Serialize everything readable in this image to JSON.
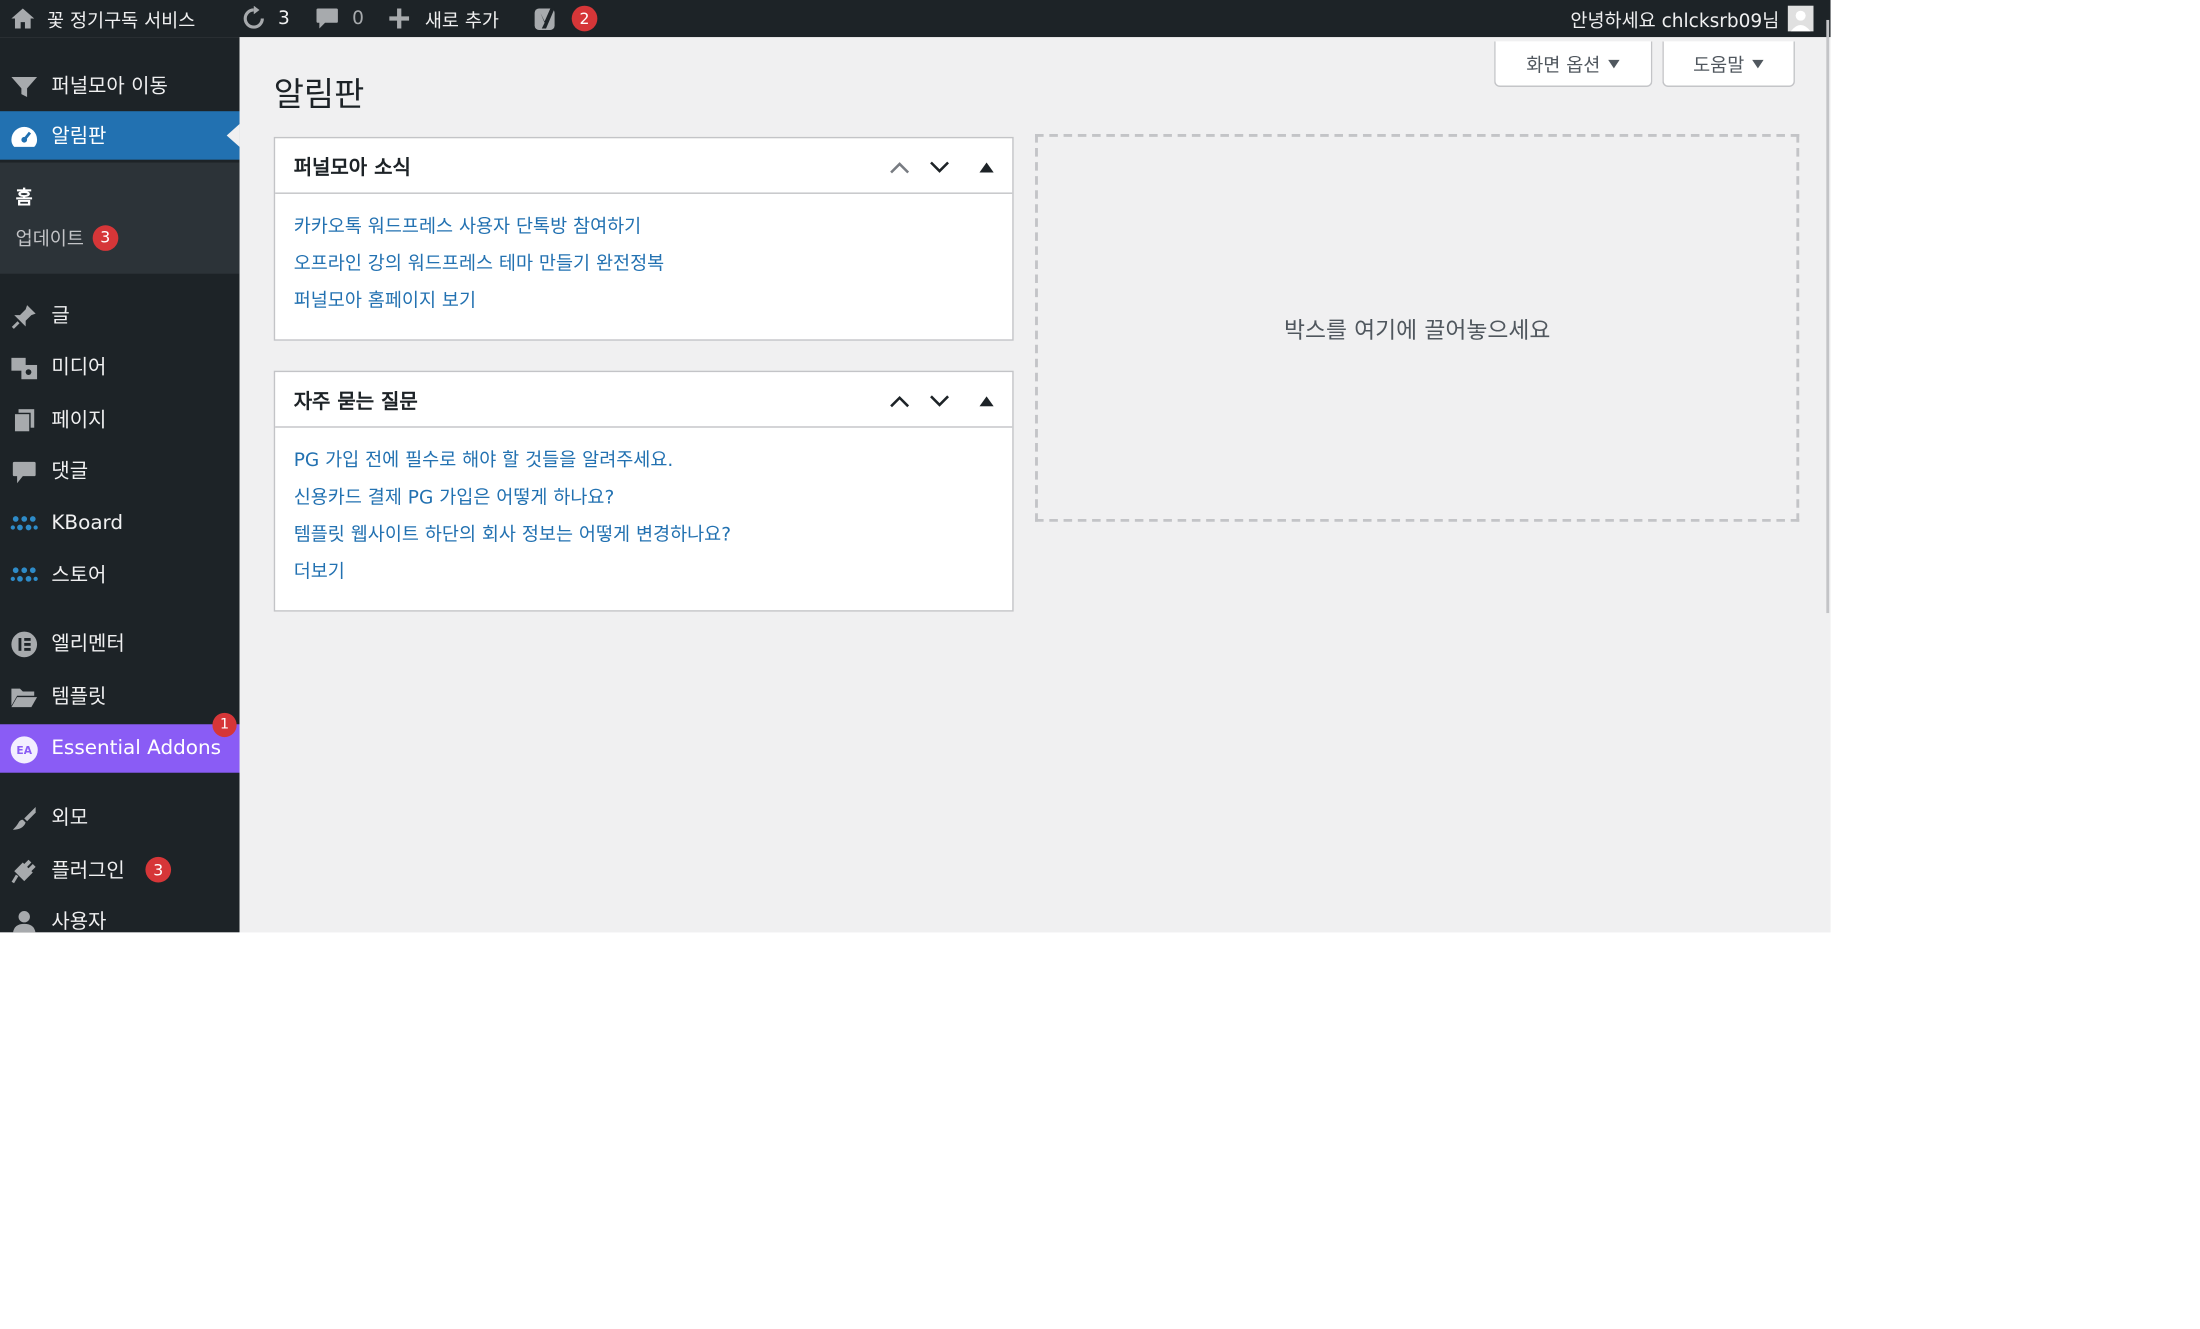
{
  "adminbar": {
    "site_name": "꽃 정기구독 서비스",
    "updates_count": "3",
    "comments_count": "0",
    "new_label": "새로 추가",
    "yoast_count": "2",
    "greeting": "안녕하세요 chlcksrb09님"
  },
  "sidebar": {
    "funnelmoa": "퍼널모아 이동",
    "dashboard": "알림판",
    "sub_home": "홈",
    "sub_updates": "업데이트",
    "sub_updates_count": "3",
    "posts": "글",
    "media": "미디어",
    "pages": "페이지",
    "comments": "댓글",
    "kboard": "KBoard",
    "store": "스토어",
    "elementor": "엘리멘터",
    "templates": "템플릿",
    "essential_addons": "Essential Addons",
    "essential_addons_count": "1",
    "appearance": "외모",
    "plugins": "플러그인",
    "plugins_count": "3",
    "users": "사용자"
  },
  "main": {
    "page_title": "알림판",
    "screen_options": "화면 옵션",
    "help": "도움말",
    "drop_zone": "박스를 여기에 끌어놓으세요"
  },
  "widgets": [
    {
      "title": "퍼널모아 소식",
      "links": [
        "카카오톡 워드프레스 사용자 단톡방 참여하기",
        "오프라인 강의 워드프레스 테마 만들기 완전정복",
        "퍼널모아 홈페이지 보기"
      ]
    },
    {
      "title": "자주 묻는 질문",
      "links": [
        "PG 가입 전에 필수로 해야 할 것들을 알려주세요.",
        "신용카드 결제 PG 가입은 어떻게 하나요?",
        "템플릿 웹사이트 하단의 회사 정보는 어떻게 변경하나요?",
        "더보기"
      ]
    }
  ],
  "colors": {
    "adminbar_bg": "#1d2327",
    "accent_blue": "#2271b1",
    "essential_addons_purple": "#8a5cf5",
    "badge_red": "#d63638",
    "content_bg": "#f0f0f1"
  }
}
